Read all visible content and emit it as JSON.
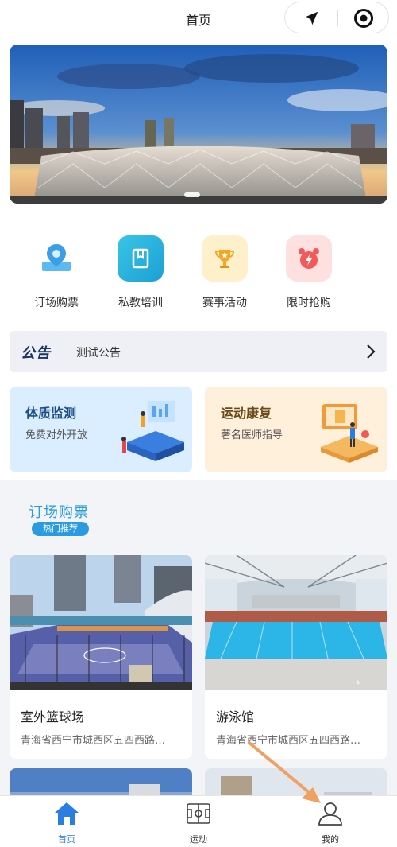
{
  "header": {
    "title": "首页"
  },
  "banner": {
    "alt": ""
  },
  "quick_menu": [
    {
      "label": "订场购票",
      "icon": "map-pin-icon",
      "color": "#3aa8ec"
    },
    {
      "label": "私教培训",
      "icon": "book-icon",
      "color": "#27b6d8"
    },
    {
      "label": "赛事活动",
      "icon": "trophy-icon",
      "color": "#f6a623"
    },
    {
      "label": "限时抢购",
      "icon": "alarm-clock-icon",
      "color": "#f25a5a"
    }
  ],
  "notice": {
    "tag": "公告",
    "text": "测试公告"
  },
  "feature_cards": [
    {
      "title": "体质监测",
      "subtitle": "免费对外开放",
      "bg": "#dbeeff",
      "title_color": "#1d4f86"
    },
    {
      "title": "运动康复",
      "subtitle": "著名医师指导",
      "bg": "#fff0db",
      "title_color": "#6a4a1a"
    }
  ],
  "section": {
    "title": "订场购票",
    "badge": "热门推荐"
  },
  "venues": [
    {
      "name": "室外篮球场",
      "address": "青海省西宁市城西区五四西路…"
    },
    {
      "name": "游泳馆",
      "address": "青海省西宁市城西区五四西路…"
    }
  ],
  "tabbar": [
    {
      "label": "首页",
      "icon": "home-icon",
      "active": true
    },
    {
      "label": "运动",
      "icon": "court-icon",
      "active": false
    },
    {
      "label": "我的",
      "icon": "user-icon",
      "active": false
    }
  ],
  "colors": {
    "accent": "#2a7de1",
    "section_blue": "#2a9be0",
    "arrow": "#f0a060"
  }
}
